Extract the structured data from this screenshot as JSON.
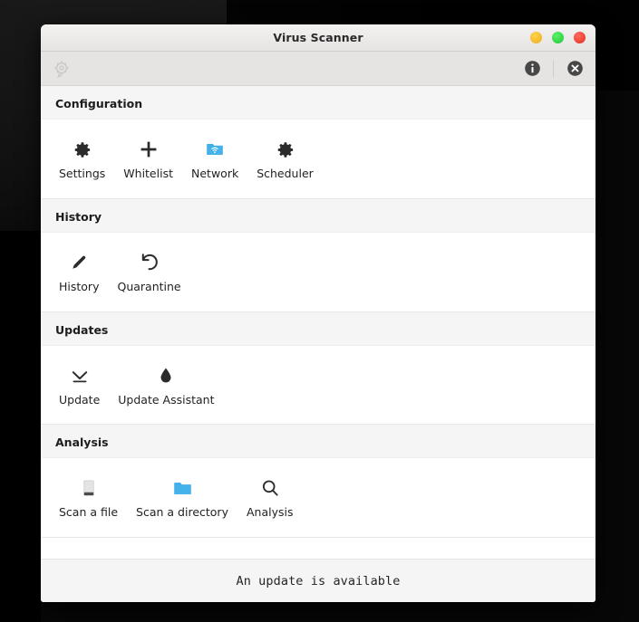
{
  "window": {
    "title": "Virus Scanner",
    "buttons": [
      {
        "name": "minimize",
        "color": "#f4bc2e"
      },
      {
        "name": "maximize",
        "color": "#35d94a"
      },
      {
        "name": "close",
        "color": "#f04438"
      }
    ]
  },
  "toolbar": {
    "left_icon": "scan-target-icon",
    "right_icons": [
      {
        "name": "info-icon",
        "label": "i"
      },
      {
        "name": "close-circle-icon",
        "label": "x"
      }
    ]
  },
  "sections": [
    {
      "title": "Configuration",
      "tiles": [
        {
          "label": "Settings",
          "icon": "gear-icon"
        },
        {
          "label": "Whitelist",
          "icon": "plus-icon"
        },
        {
          "label": "Network",
          "icon": "network-folder-icon"
        },
        {
          "label": "Scheduler",
          "icon": "gear-icon"
        }
      ]
    },
    {
      "title": "History",
      "tiles": [
        {
          "label": "History",
          "icon": "pencil-icon"
        },
        {
          "label": "Quarantine",
          "icon": "undo-arrow-icon"
        }
      ]
    },
    {
      "title": "Updates",
      "tiles": [
        {
          "label": "Update",
          "icon": "download-icon"
        },
        {
          "label": "Update Assistant",
          "icon": "droplet-icon"
        }
      ]
    },
    {
      "title": "Analysis",
      "tiles": [
        {
          "label": "Scan a file",
          "icon": "file-icon"
        },
        {
          "label": "Scan a directory",
          "icon": "folder-icon"
        },
        {
          "label": "Analysis",
          "icon": "magnifier-icon"
        }
      ]
    }
  ],
  "statusbar": {
    "message": "An update is available"
  },
  "colors": {
    "accent_blue": "#3dabe8",
    "folder_blue": "#33a5e0",
    "icon_dark": "#2b2b2b",
    "section_header_bg": "#f5f5f5",
    "content_bg": "#ffffff",
    "titlebar_bg": "#ecebe9"
  }
}
